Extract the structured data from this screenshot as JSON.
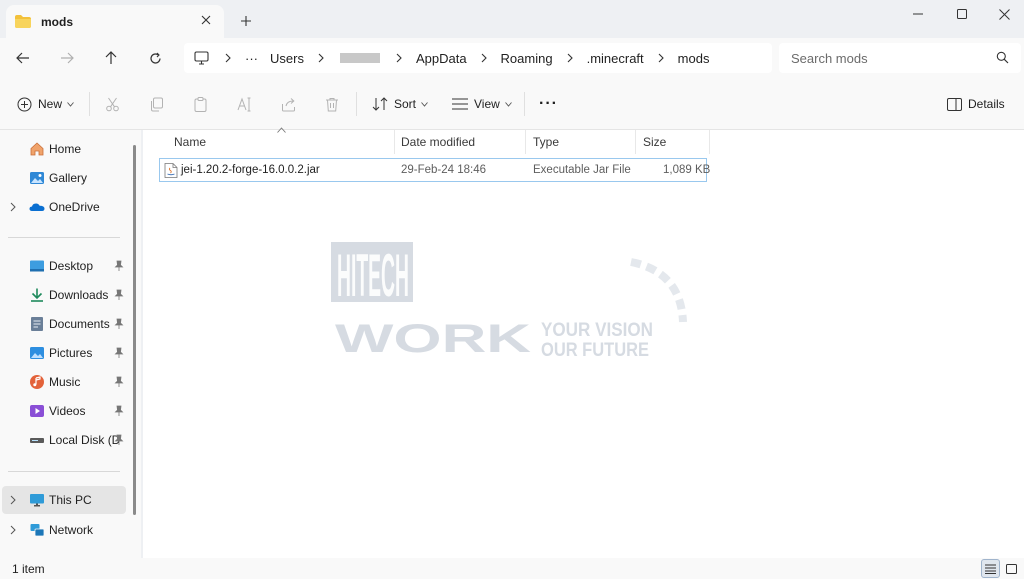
{
  "window": {
    "tab_title": "mods",
    "colors": {
      "accent": "#0067c0",
      "folder": "#f3c13a",
      "selection_border": "#99c8ee"
    }
  },
  "address": {
    "crumbs": [
      "Users",
      "AppData",
      "Roaming",
      ".minecraft",
      "mods"
    ],
    "overflow_label": "···"
  },
  "search": {
    "placeholder": "Search mods"
  },
  "toolbar": {
    "new_label": "New",
    "sort_label": "Sort",
    "view_label": "View",
    "more_label": "···",
    "details_label": "Details"
  },
  "sidebar": {
    "items": [
      {
        "label": "Home",
        "icon": "home-icon"
      },
      {
        "label": "Gallery",
        "icon": "gallery-icon"
      },
      {
        "label": "OneDrive",
        "icon": "onedrive-icon"
      },
      {
        "label": "Desktop",
        "icon": "desktop-icon"
      },
      {
        "label": "Downloads",
        "icon": "downloads-icon"
      },
      {
        "label": "Documents",
        "icon": "documents-icon"
      },
      {
        "label": "Pictures",
        "icon": "pictures-icon"
      },
      {
        "label": "Music",
        "icon": "music-icon"
      },
      {
        "label": "Videos",
        "icon": "videos-icon"
      },
      {
        "label": "Local Disk (D:)",
        "icon": "drive-icon"
      },
      {
        "label": "This PC",
        "icon": "this-pc-icon"
      },
      {
        "label": "Network",
        "icon": "network-icon"
      }
    ]
  },
  "columns": [
    "Name",
    "Date modified",
    "Type",
    "Size"
  ],
  "files": [
    {
      "name": "jei-1.20.2-forge-16.0.0.2.jar",
      "date": "29-Feb-24 18:46",
      "type": "Executable Jar File",
      "size": "1,089 KB"
    }
  ],
  "watermark": {
    "line1": "HITECH",
    "line2": "WORK",
    "tag1": "YOUR VISION",
    "tag2": "OUR FUTURE"
  },
  "status": {
    "item_count": "1 item"
  }
}
